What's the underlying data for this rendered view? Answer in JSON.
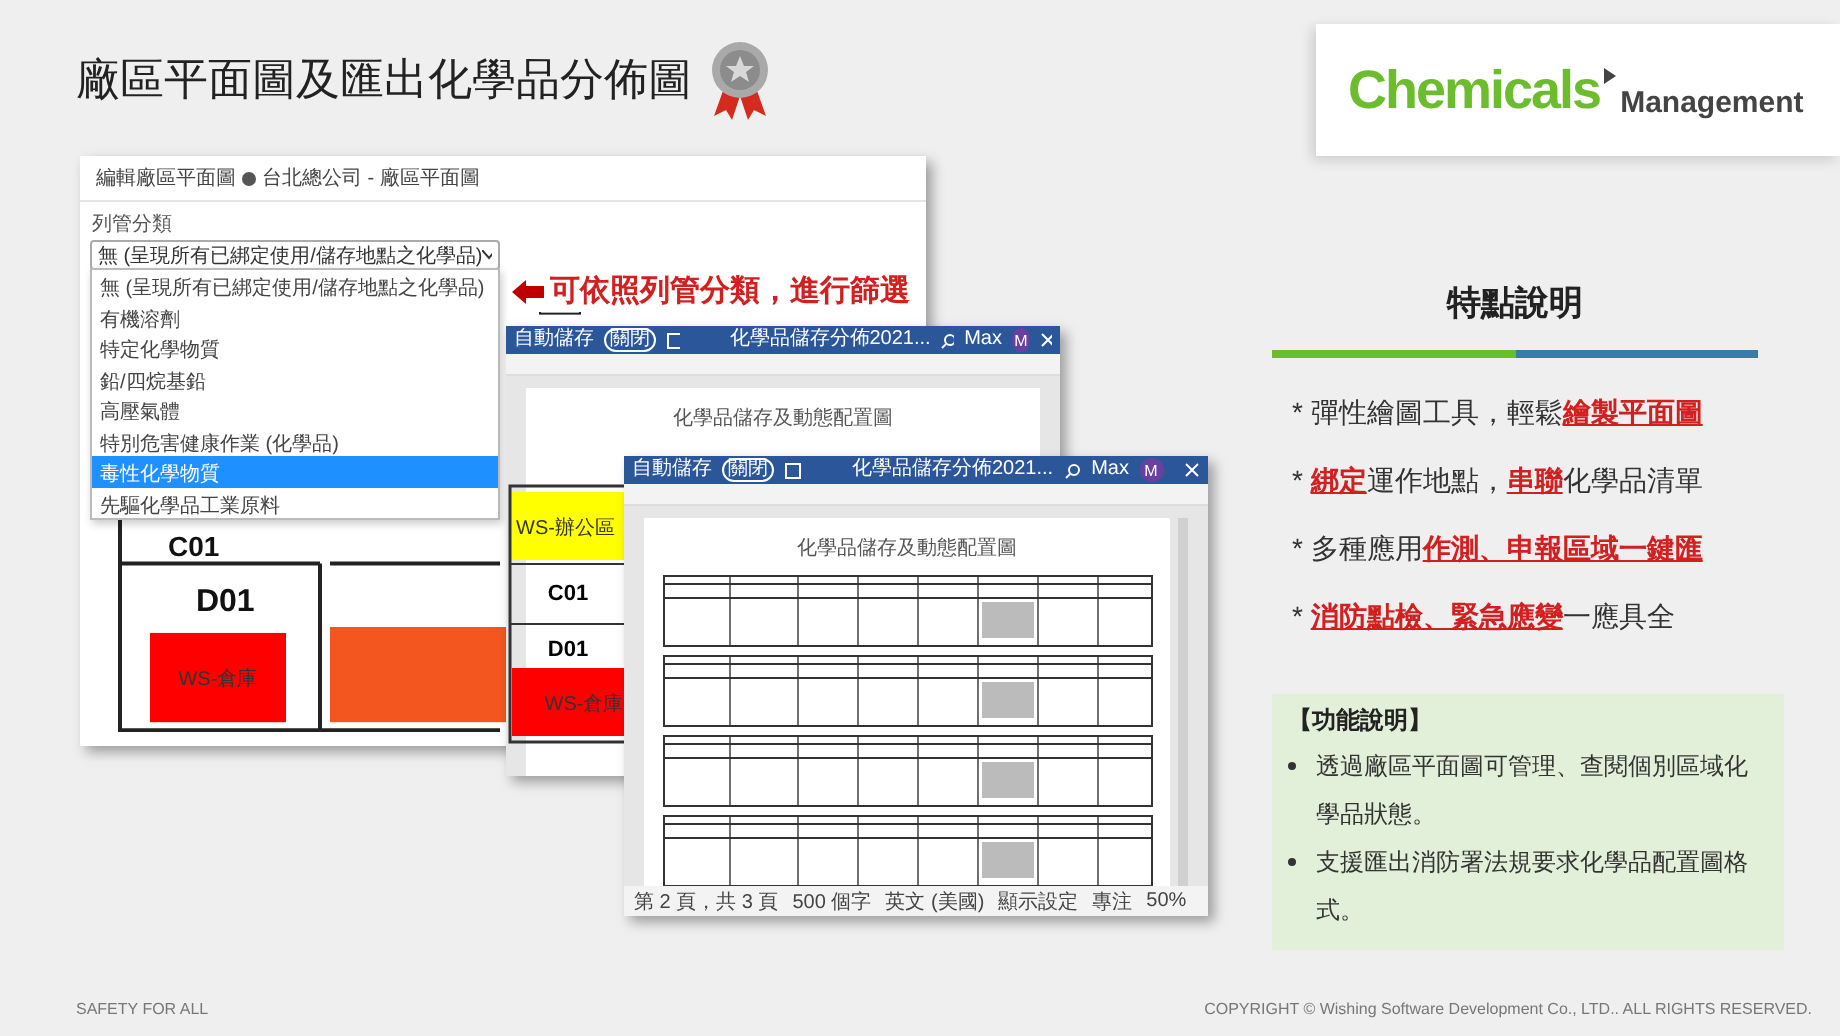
{
  "slide": {
    "title": "廠區平面圖及匯出化學品分佈圖"
  },
  "logo": {
    "word": "Chemicals",
    "sub": "Management"
  },
  "app_screenshot": {
    "breadcrumb": "編輯廠區平面圖",
    "location": "台北總公司 - 廠區平面圖",
    "filter_label": "列管分類",
    "filter_value": "無 (呈現所有已綁定使用/儲存地點之化學品)",
    "options": [
      {
        "label": "無 (呈現所有已綁定使用/儲存地點之化學品)",
        "selected": false
      },
      {
        "label": "有機溶劑",
        "selected": false
      },
      {
        "label": "特定化學物質",
        "selected": false
      },
      {
        "label": "鉛/四烷基鉛",
        "selected": false
      },
      {
        "label": "高壓氣體",
        "selected": false
      },
      {
        "label": "特別危害健康作業 (化學品)",
        "selected": false
      },
      {
        "label": "毒性化學物質",
        "selected": true
      },
      {
        "label": "先驅化學品工業原料",
        "selected": false
      }
    ],
    "callout": "可依照列管分類，進行篩選",
    "rooms": [
      "C01",
      "D01"
    ],
    "zones": [
      {
        "label": "WS-倉庫",
        "color": "#ff0000"
      },
      {
        "color": "#f4561f"
      }
    ]
  },
  "word_windows": [
    {
      "kind": "plan",
      "autosave": "自動儲存",
      "toggle": "關閉",
      "title": "化學品儲存分佈2021...",
      "user": "Max",
      "avatar": "M",
      "doc_heading": "化學品儲存及動態配置圖",
      "rooms": [
        "C01",
        "D01"
      ],
      "zones": [
        {
          "label": "WS-辦公區",
          "color": "#ffff00"
        },
        {
          "label": "WS-倉庫",
          "color": "#ff0000"
        }
      ]
    },
    {
      "kind": "table",
      "autosave": "自動儲存",
      "toggle": "關閉",
      "title": "化學品儲存分佈2021...",
      "user": "Max",
      "avatar": "M",
      "doc_heading": "化學品儲存及動態配置圖",
      "status": [
        "第 2 頁，共 3 頁",
        "500 個字",
        "英文 (美國)",
        "顯示設定",
        "專注",
        "50%"
      ]
    }
  ],
  "features": {
    "heading": "特點說明",
    "items": [
      [
        {
          "text": "* 彈性繪圖工具，輕鬆",
          "emphasis": false
        },
        {
          "text": "繪製平面圖",
          "emphasis": true
        }
      ],
      [
        {
          "text": "* ",
          "emphasis": false
        },
        {
          "text": "綁定",
          "emphasis": true
        },
        {
          "text": "運作地點，",
          "emphasis": false
        },
        {
          "text": "串聯",
          "emphasis": true
        },
        {
          "text": "化學品清單",
          "emphasis": false
        }
      ],
      [
        {
          "text": "* 多種應用",
          "emphasis": false
        },
        {
          "text": "作測、申報區域一鍵匯",
          "emphasis": true
        }
      ],
      [
        {
          "text": "* ",
          "emphasis": false
        },
        {
          "text": "消防點檢、緊急應變",
          "emphasis": true
        },
        {
          "text": "一應具全",
          "emphasis": false
        }
      ]
    ]
  },
  "function_box": {
    "title": "【功能說明】",
    "items": [
      "透過廠區平面圖可管理、查閱個別區域化學品狀態。",
      "支援匯出消防署法規要求化學品配置圖格式。"
    ]
  },
  "footer": {
    "left": "SAFETY FOR ALL",
    "right": "COPYRIGHT © Wishing Software Development Co., LTD.. ALL RIGHTS RESERVED."
  }
}
